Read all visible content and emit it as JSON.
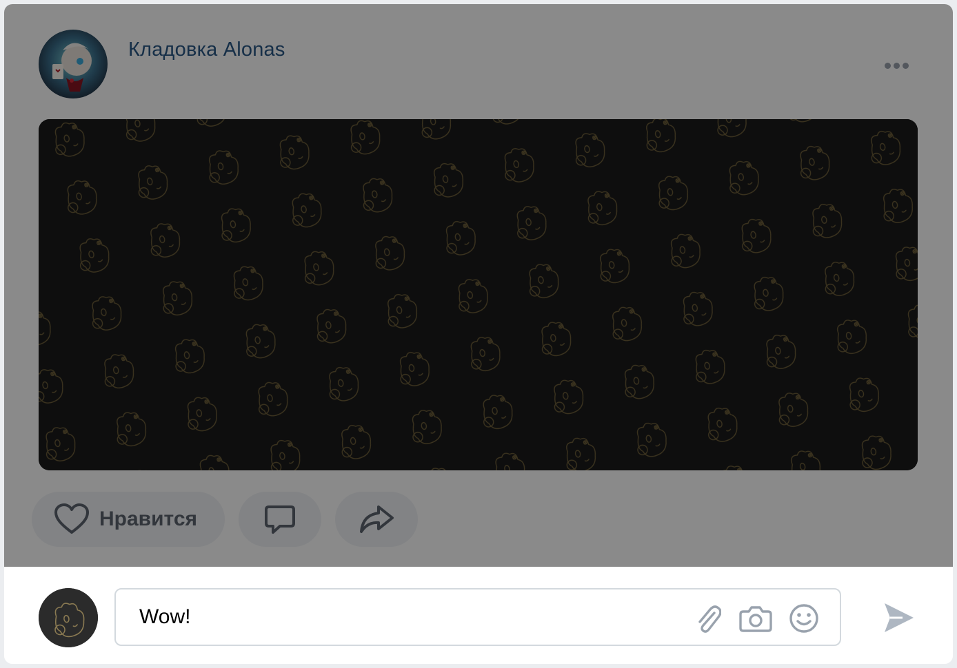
{
  "post": {
    "group_name": "Кладовка Alonas",
    "more_icon": "more-horizontal-icon",
    "image_alt": "",
    "actions": {
      "like_label": "Нравится",
      "like_icon": "heart-icon",
      "comment_icon": "comment-icon",
      "share_icon": "share-icon"
    }
  },
  "composer": {
    "input_value": "Wow!",
    "attach_icon": "paperclip-icon",
    "camera_icon": "camera-icon",
    "emoji_icon": "smile-icon",
    "send_icon": "send-icon"
  },
  "colors": {
    "link": "#2a5885",
    "icon_grey": "#99a2ad",
    "pattern_bg": "#1a1a1a",
    "pattern_line": "#c8a95a"
  }
}
